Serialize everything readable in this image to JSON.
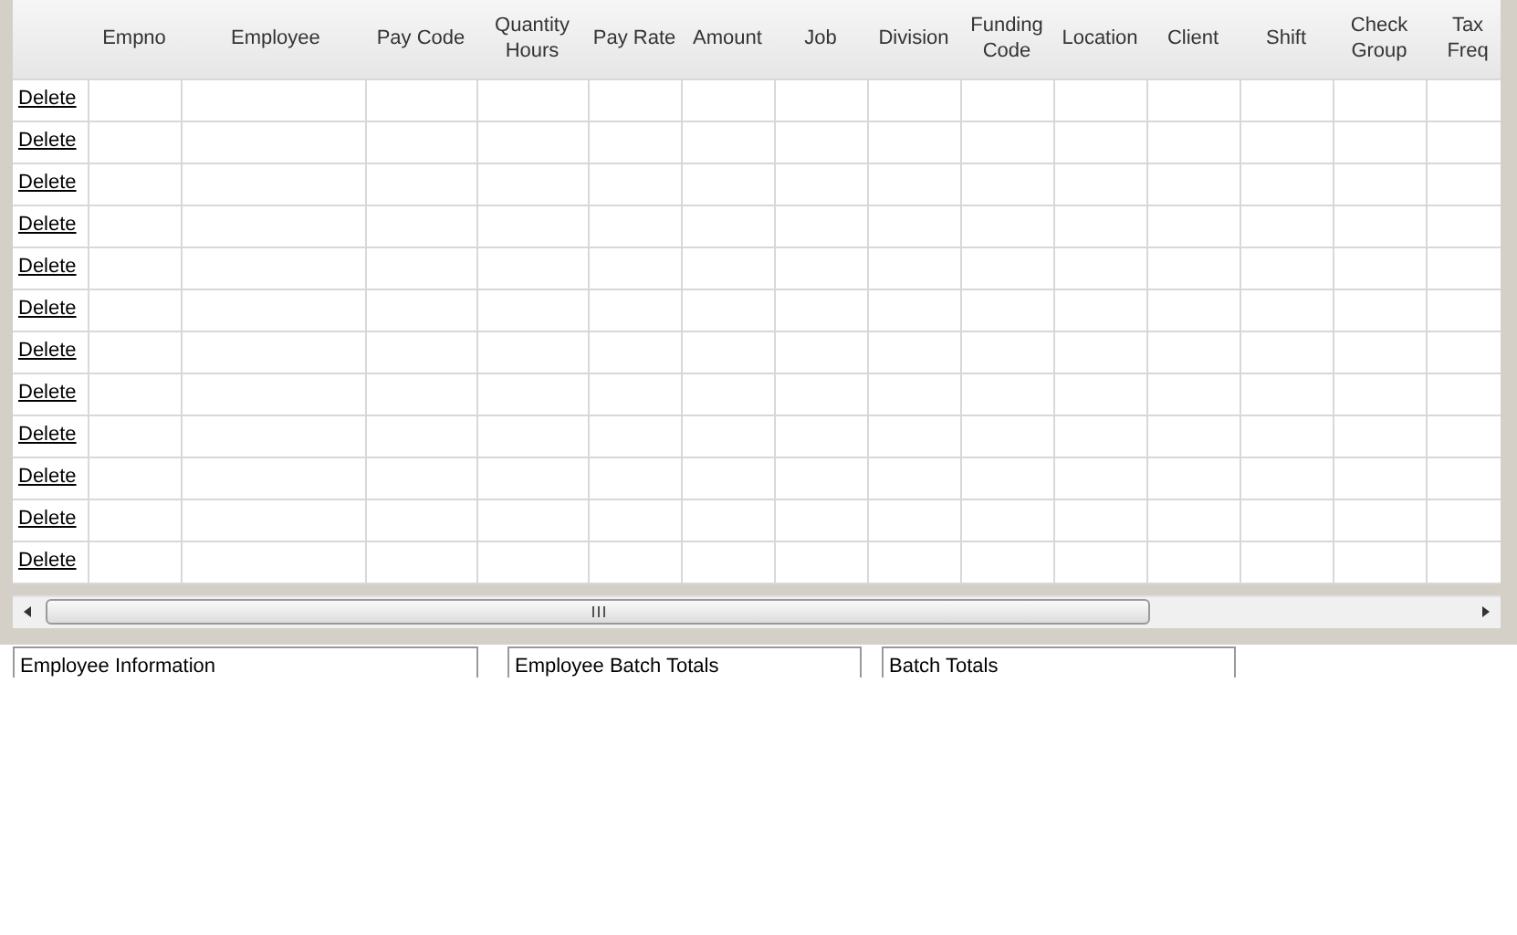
{
  "table": {
    "columns": [
      "Empno",
      "Employee",
      "Pay Code",
      "Quantity Hours",
      "Pay Rate",
      "Amount",
      "Job",
      "Division",
      "Funding Code",
      "Location",
      "Client",
      "Shift",
      "Check Group",
      "Tax Freq"
    ],
    "rows": [
      {
        "action": "Delete"
      },
      {
        "action": "Delete"
      },
      {
        "action": "Delete"
      },
      {
        "action": "Delete"
      },
      {
        "action": "Delete"
      },
      {
        "action": "Delete"
      },
      {
        "action": "Delete"
      },
      {
        "action": "Delete"
      },
      {
        "action": "Delete"
      },
      {
        "action": "Delete"
      },
      {
        "action": "Delete"
      },
      {
        "action": "Delete"
      }
    ]
  },
  "panels": [
    {
      "title": "Employee Information"
    },
    {
      "title": "Employee Batch Totals"
    },
    {
      "title": "Batch Totals"
    }
  ]
}
